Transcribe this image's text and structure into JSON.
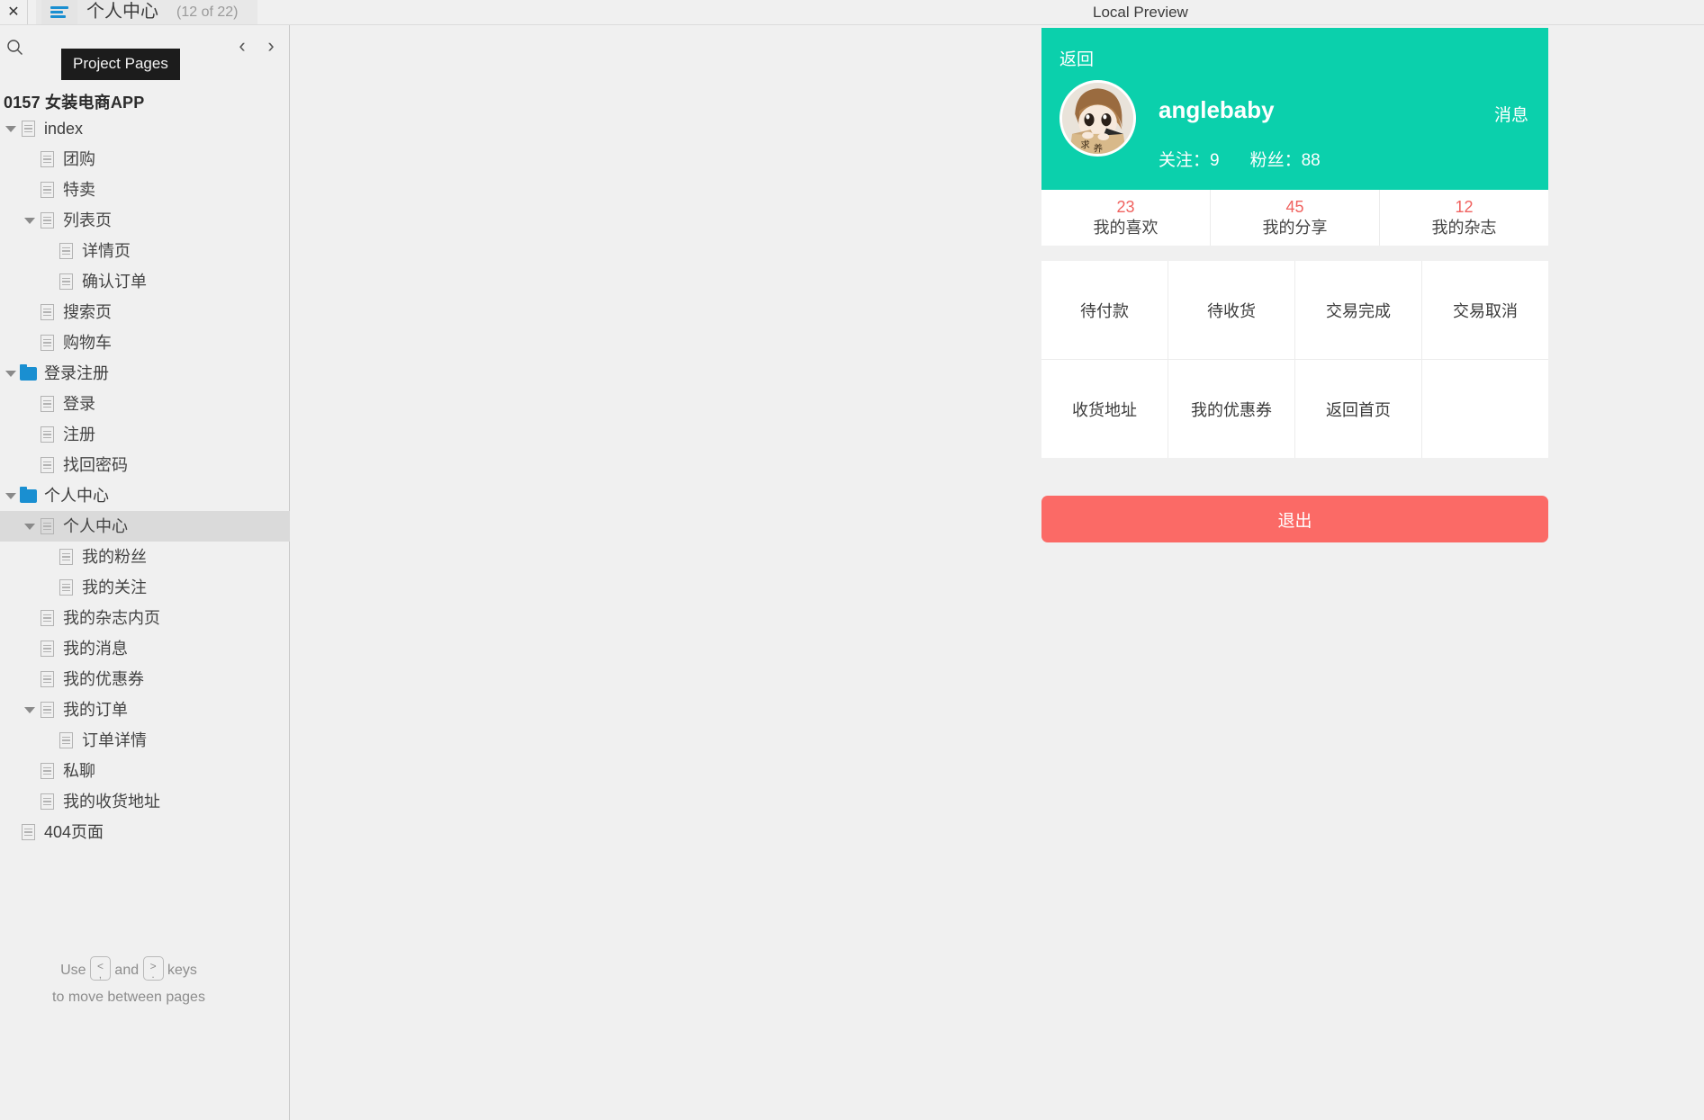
{
  "topbar": {
    "close_icon": "close-icon",
    "pages_toggle_icon": "hamburger-icon",
    "page_title": "个人中心",
    "page_counter": "(12 of 22)",
    "preview_label": "Local Preview"
  },
  "sidebar": {
    "search_icon": "search-icon",
    "prev_icon": "chevron-left-icon",
    "next_icon": "chevron-right-icon",
    "tooltip": "Project Pages",
    "project_name": "0157 女装电商APP",
    "key_hint_use": "Use",
    "key_hint_and": "and",
    "key_hint_keys": "keys",
    "key_hint_line2": "to move between pages",
    "keycap_left_up": "<",
    "keycap_left_down": ",",
    "keycap_right_up": ">",
    "keycap_right_down": ".",
    "tree": [
      {
        "label": "index",
        "level": 0,
        "icon": "page",
        "caret": true,
        "selected": false
      },
      {
        "label": "团购",
        "level": 1,
        "icon": "page",
        "caret": false,
        "selected": false
      },
      {
        "label": "特卖",
        "level": 1,
        "icon": "page",
        "caret": false,
        "selected": false
      },
      {
        "label": "列表页",
        "level": 1,
        "icon": "page",
        "caret": true,
        "selected": false
      },
      {
        "label": "详情页",
        "level": 2,
        "icon": "page",
        "caret": false,
        "selected": false
      },
      {
        "label": "确认订单",
        "level": 2,
        "icon": "page",
        "caret": false,
        "selected": false
      },
      {
        "label": "搜索页",
        "level": 1,
        "icon": "page",
        "caret": false,
        "selected": false
      },
      {
        "label": "购物车",
        "level": 1,
        "icon": "page",
        "caret": false,
        "selected": false
      },
      {
        "label": "登录注册",
        "level": 0,
        "icon": "folder",
        "caret": true,
        "selected": false
      },
      {
        "label": "登录",
        "level": 1,
        "icon": "page",
        "caret": false,
        "selected": false
      },
      {
        "label": "注册",
        "level": 1,
        "icon": "page",
        "caret": false,
        "selected": false
      },
      {
        "label": "找回密码",
        "level": 1,
        "icon": "page",
        "caret": false,
        "selected": false
      },
      {
        "label": "个人中心",
        "level": 0,
        "icon": "folder",
        "caret": true,
        "selected": false
      },
      {
        "label": "个人中心",
        "level": 1,
        "icon": "page",
        "caret": true,
        "selected": true
      },
      {
        "label": "我的粉丝",
        "level": 2,
        "icon": "page",
        "caret": false,
        "selected": false
      },
      {
        "label": "我的关注",
        "level": 2,
        "icon": "page",
        "caret": false,
        "selected": false
      },
      {
        "label": "我的杂志内页",
        "level": 1,
        "icon": "page",
        "caret": false,
        "selected": false
      },
      {
        "label": "我的消息",
        "level": 1,
        "icon": "page",
        "caret": false,
        "selected": false
      },
      {
        "label": "我的优惠券",
        "level": 1,
        "icon": "page",
        "caret": false,
        "selected": false
      },
      {
        "label": "我的订单",
        "level": 1,
        "icon": "page",
        "caret": true,
        "selected": false
      },
      {
        "label": "订单详情",
        "level": 2,
        "icon": "page",
        "caret": false,
        "selected": false
      },
      {
        "label": "私聊",
        "level": 1,
        "icon": "page",
        "caret": false,
        "selected": false
      },
      {
        "label": "我的收货地址",
        "level": 1,
        "icon": "page",
        "caret": false,
        "selected": false
      },
      {
        "label": "404页面",
        "level": 0,
        "icon": "page",
        "caret": false,
        "selected": false
      }
    ]
  },
  "preview": {
    "colors": {
      "header_green": "#0bd0ac",
      "stat_red": "#f0625f",
      "logout_red": "#fb6a66",
      "canvas_gray": "#f0f0f0"
    },
    "header": {
      "back_label": "返回",
      "avatar_icon": "avatar",
      "username": "anglebaby",
      "message_label": "消息",
      "following_label": "关注：",
      "following_count": "9",
      "fans_label": "粉丝：",
      "fans_count": "88"
    },
    "stats": [
      {
        "num": "23",
        "label": "我的喜欢"
      },
      {
        "num": "45",
        "label": "我的分享"
      },
      {
        "num": "12",
        "label": "我的杂志"
      }
    ],
    "menu_rows": [
      [
        "待付款",
        "待收货",
        "交易完成",
        "交易取消"
      ],
      [
        "收货地址",
        "我的优惠券",
        "返回首页",
        ""
      ]
    ],
    "logout_label": "退出"
  }
}
